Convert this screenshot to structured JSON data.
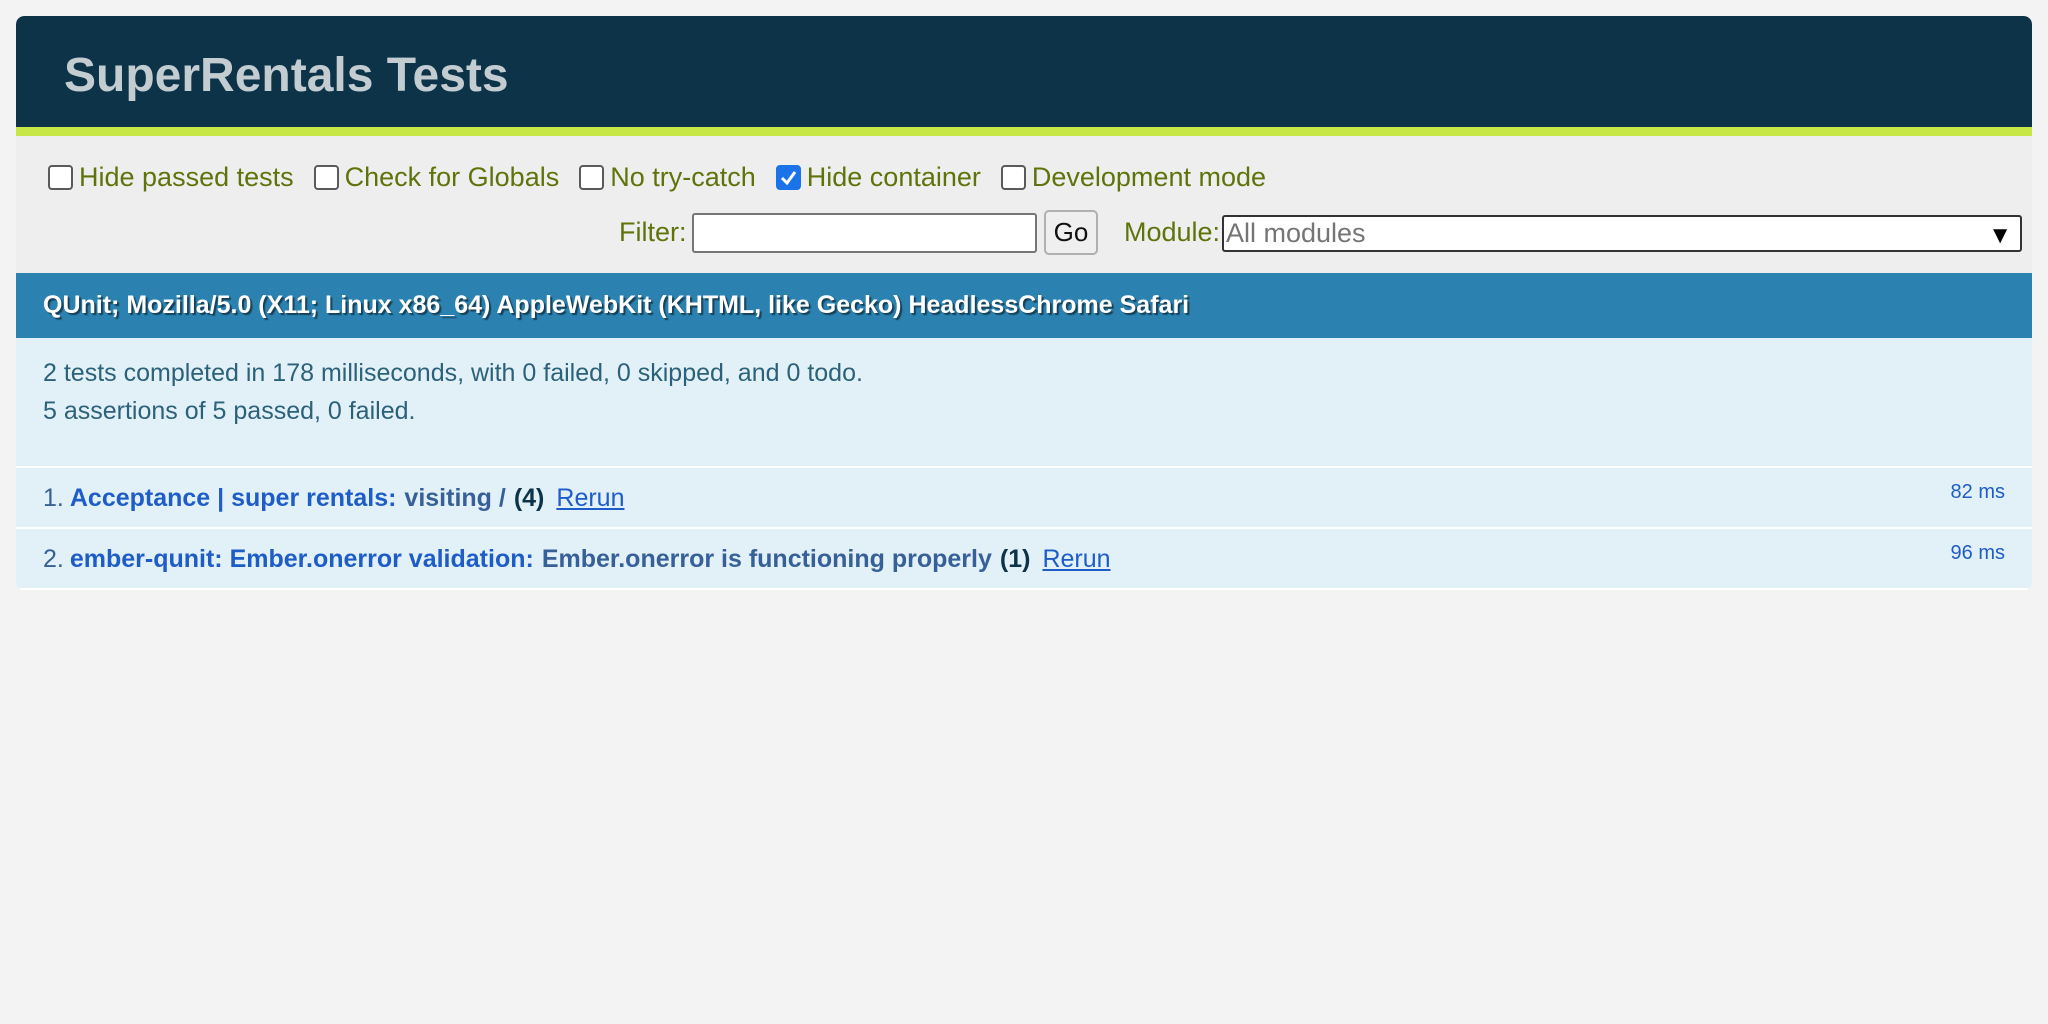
{
  "header": {
    "title": "SuperRentals Tests"
  },
  "toolbar": {
    "checkboxes": [
      {
        "label": "Hide passed tests",
        "checked": false
      },
      {
        "label": "Check for Globals",
        "checked": false
      },
      {
        "label": "No try-catch",
        "checked": false
      },
      {
        "label": "Hide container",
        "checked": true
      },
      {
        "label": "Development mode",
        "checked": false
      }
    ],
    "filter_label": "Filter:",
    "filter_value": "",
    "go_label": "Go",
    "module_label": "Module:",
    "module_selected": "All modules",
    "module_arrow": "▼"
  },
  "user_agent": "QUnit; Mozilla/5.0 (X11; Linux x86_64) AppleWebKit (KHTML, like Gecko) HeadlessChrome Safari",
  "summary": {
    "line1": "2 tests completed in 178 milliseconds, with 0 failed, 0 skipped, and 0 todo.",
    "line2": "5 assertions of 5 passed, 0 failed."
  },
  "tests": [
    {
      "number": "1.",
      "module": "Acceptance | super rentals:",
      "name": "visiting /",
      "counts": "(4)",
      "rerun": "Rerun",
      "runtime": "82 ms"
    },
    {
      "number": "2.",
      "module": "ember-qunit: Ember.onerror validation:",
      "name": "Ember.onerror is functioning properly",
      "counts": "(1)",
      "rerun": "Rerun",
      "runtime": "96 ms"
    }
  ],
  "colors": {
    "header_bg": "#0d3349",
    "header_accent": "#c6e746",
    "user_agent_bg": "#2b81af",
    "result_bg": "#e2f0f7",
    "toolbar_text": "#5e740b",
    "link_blue": "#1e5dc7"
  }
}
